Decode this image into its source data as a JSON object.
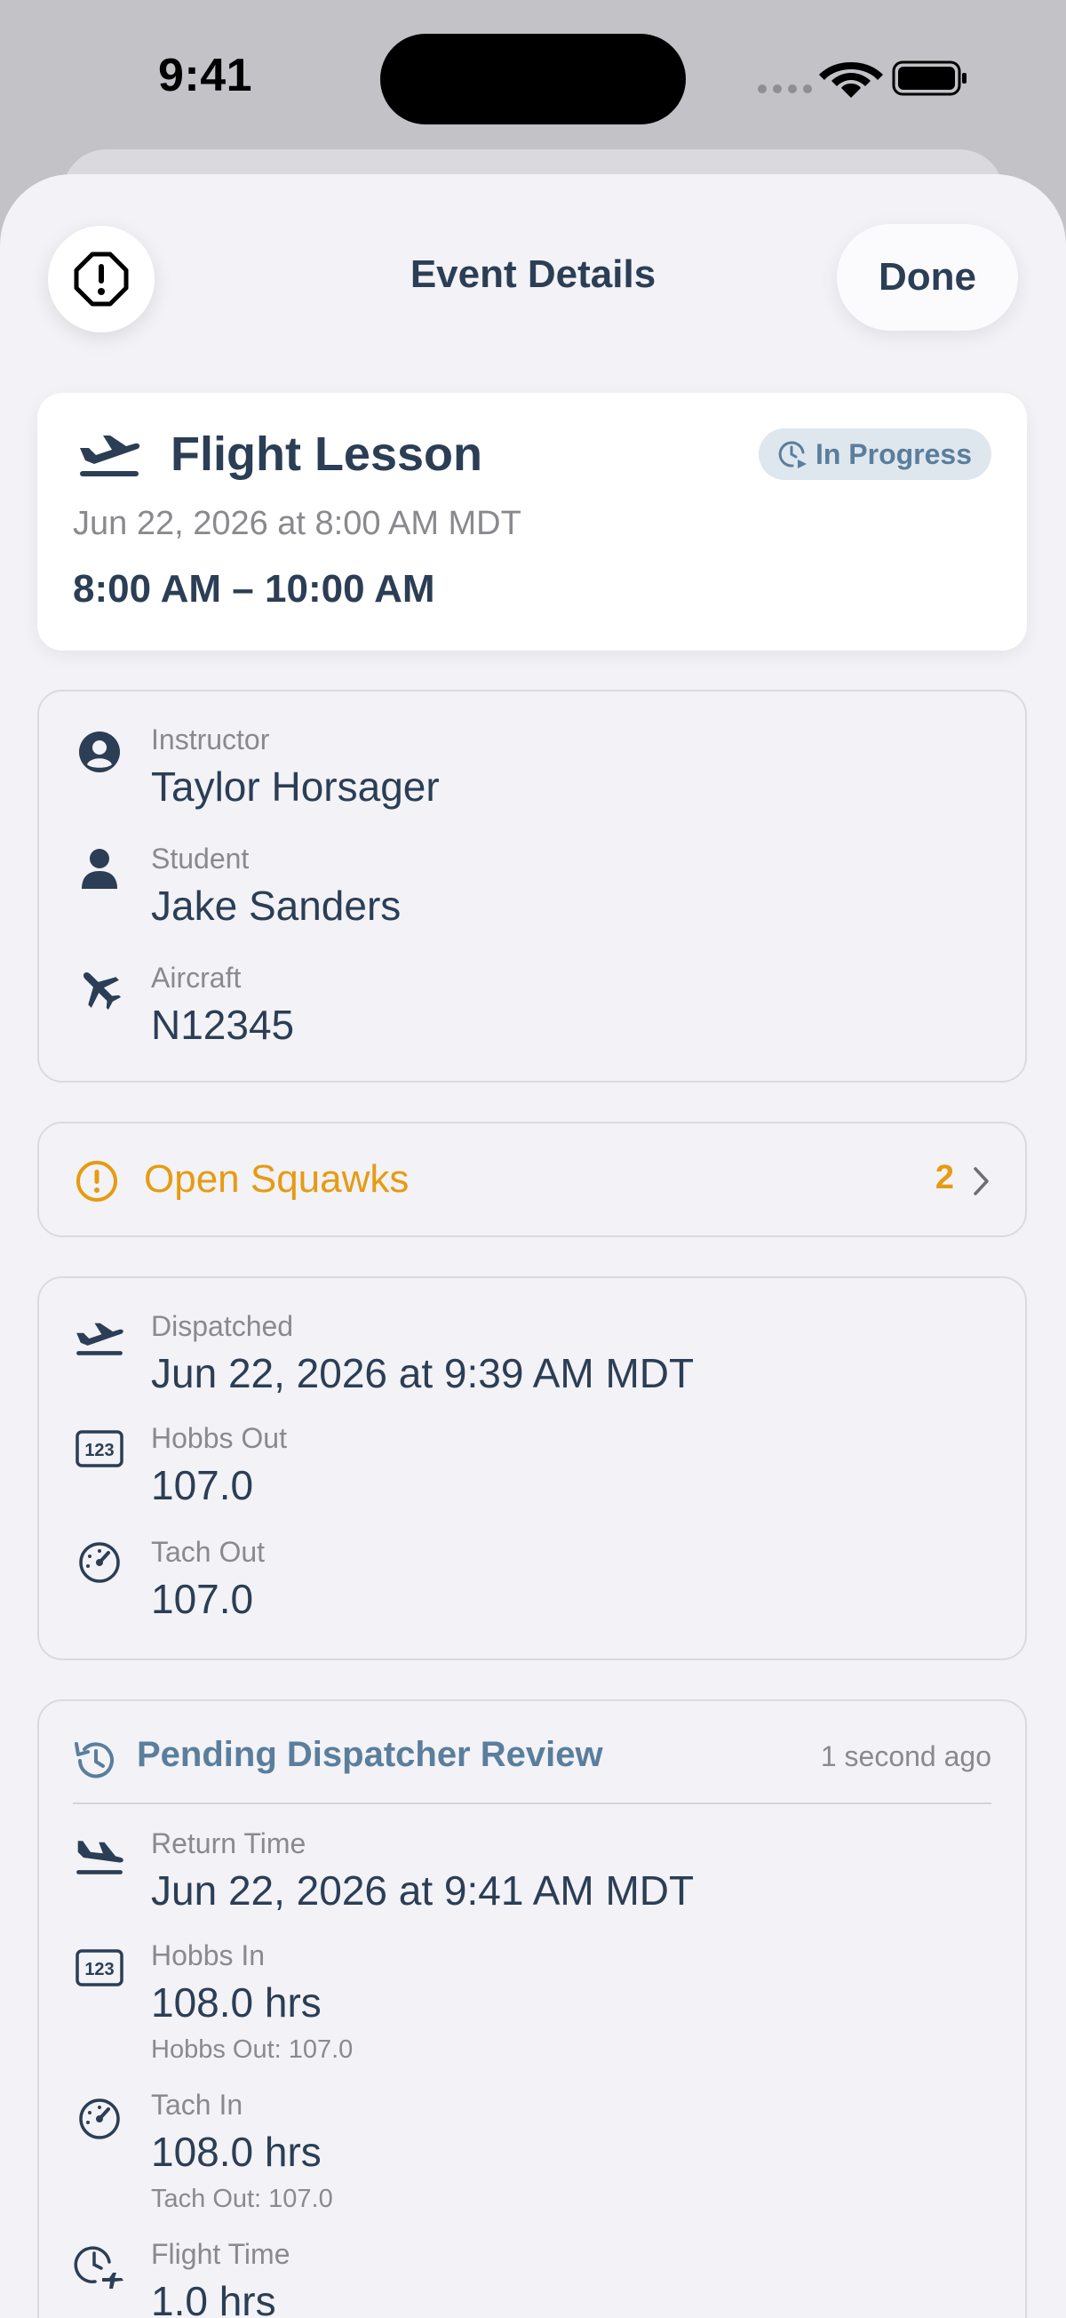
{
  "status_bar": {
    "time": "9:41"
  },
  "header": {
    "title": "Event Details",
    "done_label": "Done"
  },
  "event": {
    "title": "Flight Lesson",
    "status": "In Progress",
    "date_line": "Jun 22, 2026 at 8:00 AM MDT",
    "time_range": "8:00 AM – 10:00 AM"
  },
  "people": {
    "instructor_label": "Instructor",
    "instructor": "Taylor Horsager",
    "student_label": "Student",
    "student": "Jake Sanders",
    "aircraft_label": "Aircraft",
    "aircraft": "N12345"
  },
  "squawks": {
    "label": "Open Squawks",
    "count": "2"
  },
  "dispatch": {
    "dispatched_label": "Dispatched",
    "dispatched": "Jun 22, 2026 at 9:39 AM MDT",
    "hobbs_out_label": "Hobbs Out",
    "hobbs_out": "107.0",
    "tach_out_label": "Tach Out",
    "tach_out": "107.0"
  },
  "review": {
    "title": "Pending Dispatcher Review",
    "ago": "1 second ago",
    "return_label": "Return Time",
    "return_time": "Jun 22, 2026 at 9:41 AM MDT",
    "hobbs_in_label": "Hobbs In",
    "hobbs_in": "108.0 hrs",
    "hobbs_in_sub": "Hobbs Out: 107.0",
    "tach_in_label": "Tach In",
    "tach_in": "108.0 hrs",
    "tach_in_sub": "Tach Out: 107.0",
    "flight_time_label": "Flight Time",
    "flight_time": "1.0 hrs"
  },
  "colors": {
    "primary": "#2b3e55",
    "warning": "#e69b11",
    "accent": "#5a7e9c",
    "muted": "#8a8a8e"
  }
}
